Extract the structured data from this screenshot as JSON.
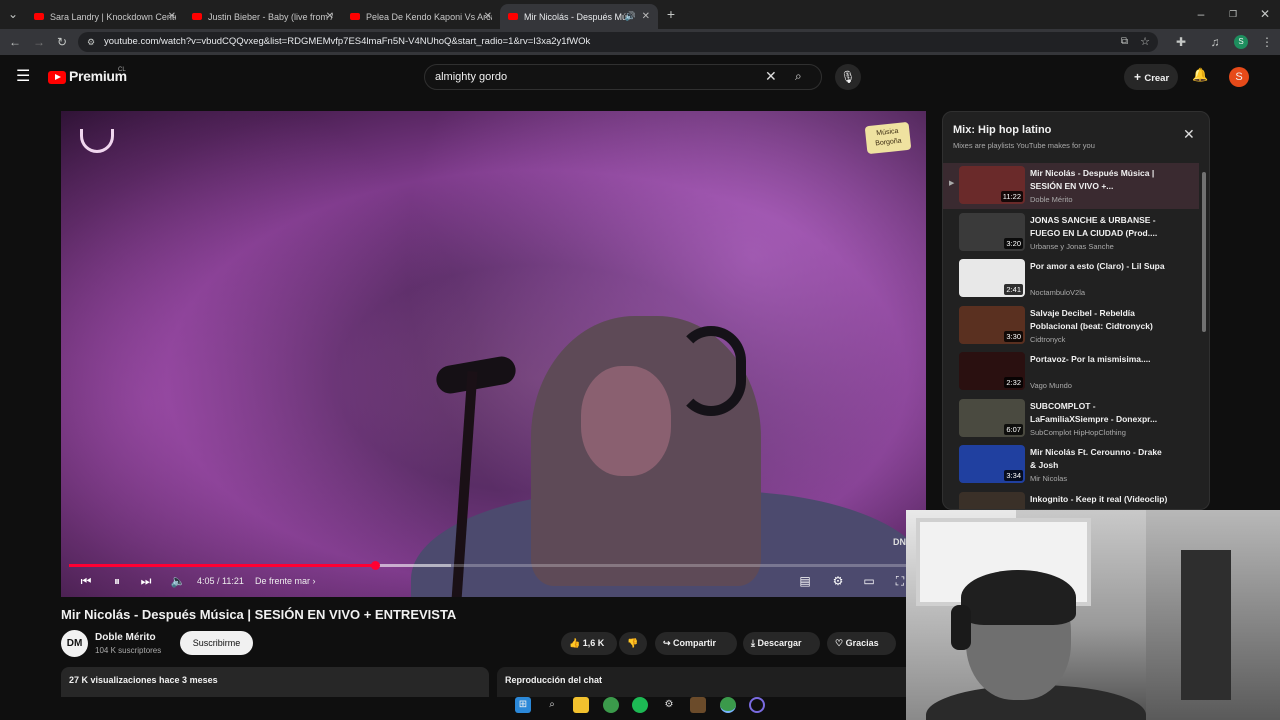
{
  "browser": {
    "tabs": [
      {
        "title": "Sara Landry | Knockdown Cente"
      },
      {
        "title": "Justin Bieber - Baby (live from /"
      },
      {
        "title": "Pelea De Kendo Kaponi Vs Arca"
      },
      {
        "title": "Mir Nicolás - Después Músi"
      }
    ],
    "url": "youtube.com/watch?v=vbudCQQvxeg&list=RDGMEMvfp7ES4lmaFn5N-V4NUhoQ&start_radio=1&rv=I3xa2y1fWOk"
  },
  "header": {
    "logo_text": "Premium",
    "logo_region": "CL",
    "search_value": "almighty gordo",
    "create_label": "Crear",
    "avatar_letter": "S"
  },
  "player": {
    "current_time": "4:05 / 11:21",
    "chapter": "De frente mar",
    "progress_fraction": 0.36,
    "buffer_fraction": 0.45,
    "badge_text": "Música Borgoña",
    "accent_color": "#ff0033"
  },
  "video": {
    "title": "Mir Nicolás - Después Música | SESIÓN EN VIVO + ENTREVISTA",
    "channel": "Doble Mérito",
    "subscribers": "104 K suscriptores",
    "subscribe_label": "Suscribirme",
    "likes": "1,6 K",
    "share_label": "Compartir",
    "download_label": "Descargar",
    "thanks_label": "Gracias",
    "views": "27 K visualizaciones  hace 3 meses",
    "chat_label": "Reproducción del chat"
  },
  "playlist": {
    "title": "Mix: Hip hop latino",
    "subtitle": "Mixes are playlists YouTube makes for you",
    "items": [
      {
        "title": "Mir Nicolás - Después Música | SESIÓN EN VIVO +...",
        "channel": "Doble Mérito",
        "duration": "11:22",
        "color": "#6a2a2a"
      },
      {
        "title": "JONAS SANCHE & URBANSE - FUEGO EN LA CIUDAD (Prod....",
        "channel": "Urbanse y Jonas Sanche",
        "duration": "3:20",
        "color": "#3a3a3a"
      },
      {
        "title": "Por amor a esto (Claro) - Lil Supa",
        "channel": "NoctambuloV2la",
        "duration": "2:41",
        "color": "#e8e8e8"
      },
      {
        "title": "Salvaje Decibel - Rebeldía Poblacional (beat: Cidtronyck)",
        "channel": "Cidtronyck",
        "duration": "3:30",
        "color": "#5a3020"
      },
      {
        "title": "Portavoz- Por la mismisima....",
        "channel": "Vago Mundo",
        "duration": "2:32",
        "color": "#2a1010"
      },
      {
        "title": "SUBCOMPLOT - LaFamiliaXSiempre - Donexpr...",
        "channel": "SubComplot HipHopClothing",
        "duration": "6:07",
        "color": "#4a4a40"
      },
      {
        "title": "Mir Nicolás Ft. Cerounno - Drake & Josh",
        "channel": "Mir Nicolas",
        "duration": "3:34",
        "color": "#2040a0"
      },
      {
        "title": "Inkognito - Keep it real (Videoclip)",
        "channel": "",
        "duration": "",
        "color": "#3a3028"
      }
    ]
  }
}
